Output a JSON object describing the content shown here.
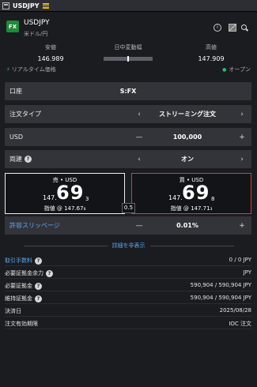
{
  "window": {
    "title": "USDJPY"
  },
  "header": {
    "logo": "FX",
    "symbol": "USDJPY",
    "symbol_sub": "米ドル/円"
  },
  "stats": {
    "low_label": "安値",
    "low_value": "146.989",
    "range_label": "日中変動幅",
    "range_position": 0.5,
    "high_label": "高値",
    "high_value": "147.909",
    "realtime_label": "リアルタイム価格",
    "open_label": "オープン"
  },
  "form": {
    "account_label": "口座",
    "account_value": "S:FX",
    "order_type_label": "注文タイプ",
    "order_type_value": "ストリーミング注文",
    "quantity_label": "USD",
    "quantity_value": "100,000",
    "both_sides_label": "両建",
    "both_sides_value": "オン",
    "slippage_label": "許容スリッページ",
    "slippage_value": "0.01%"
  },
  "sell": {
    "title": "売 • USD",
    "prefix": "147.",
    "big": "69",
    "sub": "3",
    "limit": "指値 @ 147.67₈"
  },
  "buy": {
    "title": "買 • USD",
    "prefix": "147.",
    "big": "69",
    "sub": "8",
    "limit": "指値 @ 147.71₃"
  },
  "spread": "0.5",
  "details_toggle": "詳細を非表示",
  "details": [
    {
      "key": "取引手数料",
      "value": "0 / 0 JPY",
      "help": true,
      "link": true
    },
    {
      "key": "必要証拠金余力",
      "value": "JPY",
      "help": true,
      "link": false
    },
    {
      "key": "必要証拠金",
      "value": "590,904 / 590,904 JPY",
      "help": true,
      "link": false
    },
    {
      "key": "維持証拠金",
      "value": "590,904 / 590,904 JPY",
      "help": true,
      "link": false
    },
    {
      "key": "決済日",
      "value": "2025/08/28",
      "help": false,
      "link": false
    },
    {
      "key": "注文有効期限",
      "value": "IOC 注文",
      "help": false,
      "link": false
    }
  ],
  "colors": {
    "accent_blue": "#5aa7ee",
    "sell_border": "#eeeeee",
    "buy_border": "#d83b3b",
    "status_green": "#25c26e"
  }
}
